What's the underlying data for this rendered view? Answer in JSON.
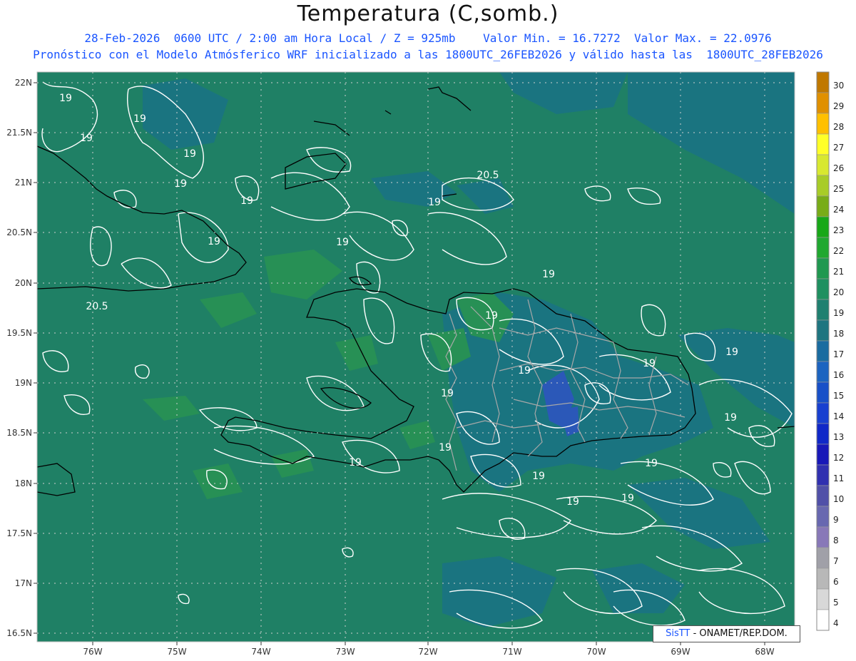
{
  "title": "Temperatura (C,somb.)",
  "subtitle1": "28-Feb-2026  0600 UTC / 2:00 am Hora Local / Z = 925mb    Valor Min. = 16.7272  Valor Max. = 22.0976",
  "subtitle2": "Pronóstico con el Modelo Atmósferico WRF inicializado a las 1800UTC_26FEB2026 y válido hasta las  1800UTC_28FEB2026",
  "credit": {
    "sis": "SisTT",
    "rest": " - ONAMET/REP.DOM."
  },
  "colors": {
    "base_fill": "#1f8065",
    "warm_patch": "#279055",
    "cool_patch": "#1a7480",
    "cold_patch": "#2b58b8",
    "coast": "#000000",
    "provinces": "#a8a8a8",
    "contour": "#ffffff"
  },
  "map": {
    "lon_labels": [
      "76W",
      "75W",
      "74W",
      "73W",
      "72W",
      "71W",
      "70W",
      "69W",
      "68W"
    ],
    "lat_labels": [
      "22N",
      "21.5N",
      "21N",
      "20.5N",
      "20N",
      "19.5N",
      "19N",
      "18.5N",
      "18N",
      "17.5N",
      "17N",
      "16.5N"
    ],
    "contour_labels": [
      "19",
      "19",
      "19",
      "19",
      "19",
      "19",
      "19",
      "19",
      "19",
      "20.5",
      "19",
      "19",
      "20.5",
      "19",
      "19",
      "19",
      "19",
      "19",
      "19",
      "19",
      "19",
      "19",
      "19",
      "19"
    ]
  },
  "colorbar": {
    "levels": [
      "30",
      "29",
      "28",
      "27",
      "26",
      "25",
      "24",
      "23",
      "22",
      "21",
      "20",
      "19",
      "18",
      "17",
      "16",
      "15",
      "14",
      "13",
      "12",
      "11",
      "10",
      "9",
      "8",
      "7",
      "6",
      "5",
      "4"
    ],
    "colors": [
      "#c07800",
      "#e09000",
      "#ffc000",
      "#ffff28",
      "#d8e830",
      "#a8cc28",
      "#78ac18",
      "#18a818",
      "#20a830",
      "#209850",
      "#1f9060",
      "#1f8070",
      "#1e7580",
      "#1a6ca0",
      "#1c64c0",
      "#1850c8",
      "#1840d0",
      "#1028c8",
      "#1818b8",
      "#3030b0",
      "#5050a8",
      "#6868b0",
      "#8878b8",
      "#a0a0a8",
      "#b8b8b8",
      "#d8d8d8",
      "#ffffff"
    ]
  }
}
